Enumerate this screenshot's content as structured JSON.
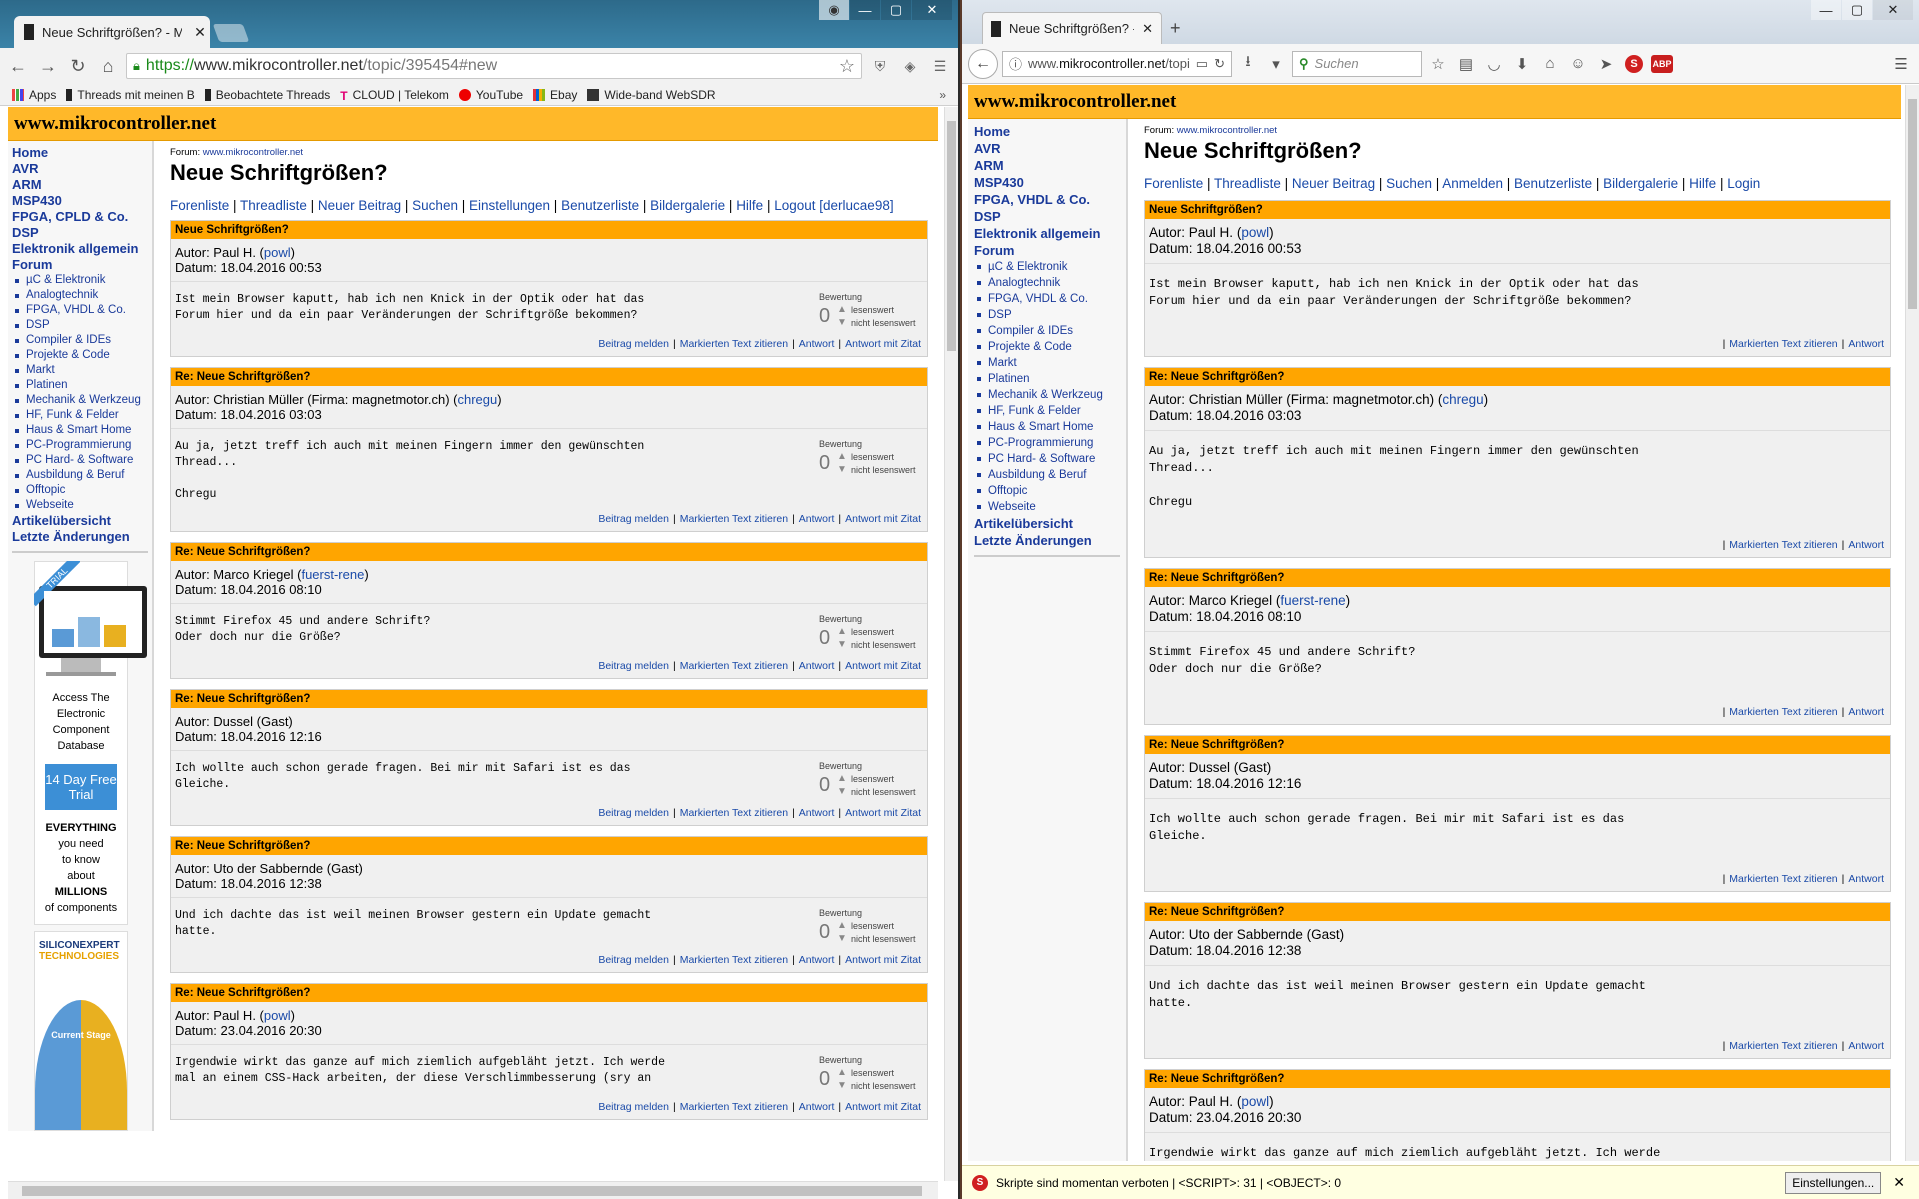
{
  "chrome": {
    "tab_title": "Neue Schriftgrößen? - Mi",
    "url_scheme": "https://",
    "url_host": "www.mikrocontroller.net",
    "url_path": "/topic/395454#new",
    "bookmarks": [
      "Apps",
      "Threads mit meinen B",
      "Beobachtete Threads",
      "CLOUD | Telekom",
      "YouTube",
      "Ebay",
      "Wide-band WebSDR"
    ],
    "bookmarks_more": "»"
  },
  "firefox": {
    "tab_title": "Neue Schriftgrößen? - Mikr...",
    "url_prefix": "www.",
    "url_host": "mikrocontroller.net",
    "url_path": "/topic/395454#n",
    "search_placeholder": "Suchen",
    "abp_label": "ABP",
    "noscript_message": "Skripte sind momentan verboten | <SCRIPT>: 31 | <OBJECT>: 0",
    "noscript_button": "Einstellungen..."
  },
  "site": {
    "header": "www.mikrocontroller.net",
    "forum_label_prefix": "Forum: ",
    "forum_label_link": "www.mikrocontroller.net",
    "title": "Neue Schriftgrößen?",
    "nav_left": [
      "Forenliste",
      "Threadliste",
      "Neuer Beitrag",
      "Suchen",
      "Einstellungen",
      "Benutzerliste",
      "Bildergalerie",
      "Hilfe",
      "Logout",
      "[derlucae98]"
    ],
    "nav_right": [
      "Forenliste",
      "Threadliste",
      "Neuer Beitrag",
      "Suchen",
      "Anmelden",
      "Benutzerliste",
      "Bildergalerie",
      "Hilfe",
      "Login"
    ],
    "sidebar_top": [
      "Home",
      "AVR",
      "ARM",
      "MSP430",
      "FPGA, CPLD & Co.",
      "DSP",
      "Elektronik allgemein",
      "Forum"
    ],
    "sidebar_top_right": [
      "Home",
      "AVR",
      "ARM",
      "MSP430",
      "FPGA, VHDL & Co.",
      "DSP",
      "Elektronik allgemein",
      "Forum"
    ],
    "sidebar_sub": [
      "µC & Elektronik",
      "Analogtechnik",
      "FPGA, VHDL & Co.",
      "DSP",
      "Compiler & IDEs",
      "Projekte & Code",
      "Markt",
      "Platinen",
      "Mechanik & Werkzeug",
      "HF, Funk & Felder",
      "Haus & Smart Home",
      "PC-Programmierung",
      "PC Hard- & Software",
      "Ausbildung & Beruf",
      "Offtopic",
      "Webseite"
    ],
    "sidebar_bottom": [
      "Artikelübersicht",
      "Letzte Änderungen"
    ],
    "ad": {
      "ribbon": "TRIAL",
      "lines": [
        "Access The",
        "Electronic",
        "Component",
        "Database"
      ],
      "button": "14 Day Free Trial",
      "lines2": [
        "EVERYTHING",
        "you need",
        "to know",
        "about",
        "MILLIONS",
        "of components"
      ],
      "logo": "SILICONEXPERT",
      "logo_sub": "TECHNOLOGIES",
      "stage": "Current Stage"
    },
    "rating_label": "Bewertung",
    "rating_up": "lesenswert",
    "rating_down": "nicht lesenswert",
    "actions_left": [
      "Beitrag melden",
      "Markierten Text zitieren",
      "Antwort",
      "Antwort mit Zitat"
    ],
    "actions_right": [
      "Markierten Text zitieren",
      "Antwort"
    ],
    "author_prefix": "Autor: ",
    "date_prefix": "Datum: ",
    "posts": [
      {
        "head": "Neue Schriftgrößen?",
        "author": "Paul H.",
        "user": "powl",
        "date": "18.04.2016 00:53",
        "text": "Ist mein Browser kaputt, hab ich nen Knick in der Optik oder hat das\nForum hier und da ein paar Veränderungen der Schriftgröße bekommen?",
        "score": "0"
      },
      {
        "head": "Re: Neue Schriftgrößen?",
        "author": "Christian Müller (Firma: magnetmotor.ch)",
        "user": "chregu",
        "date": "18.04.2016 03:03",
        "text": "Au ja, jetzt treff ich auch mit meinen Fingern immer den gewünschten\nThread...\n\nChregu",
        "score": "0"
      },
      {
        "head": "Re: Neue Schriftgrößen?",
        "author": "Marco Kriegel",
        "user": "fuerst-rene",
        "date": "18.04.2016 08:10",
        "text": "Stimmt Firefox 45 und andere Schrift?\nOder doch nur die Größe?",
        "score": "0"
      },
      {
        "head": "Re: Neue Schriftgrößen?",
        "author": "Dussel (Gast)",
        "user": "",
        "date": "18.04.2016 12:16",
        "text": "Ich wollte auch schon gerade fragen. Bei mir mit Safari ist es das\nGleiche.",
        "score": "0"
      },
      {
        "head": "Re: Neue Schriftgrößen?",
        "author": "Uto der Sabbernde (Gast)",
        "user": "",
        "date": "18.04.2016 12:38",
        "text": "Und ich dachte das ist weil meinen Browser gestern ein Update gemacht\nhatte.",
        "score": "0"
      },
      {
        "head": "Re: Neue Schriftgrößen?",
        "author": "Paul H.",
        "user": "powl",
        "date": "23.04.2016 20:30",
        "text": "Irgendwie wirkt das ganze auf mich ziemlich aufgebläht jetzt. Ich werde\nmal an einem CSS-Hack arbeiten, der diese Verschlimmbesserung (sry an",
        "score": "0"
      }
    ]
  }
}
